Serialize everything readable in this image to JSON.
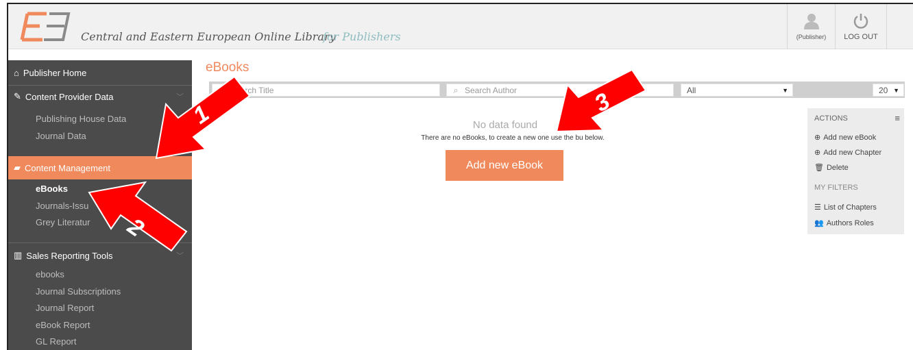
{
  "header": {
    "brand": "Central and Eastern European Online Library",
    "brand_sub": "for Publishers",
    "user_label": "(Publisher)",
    "logout_label": "LOG OUT"
  },
  "sidebar": {
    "home": "Publisher Home",
    "content_provider": {
      "label": "Content Provider Data",
      "items": [
        "Publishing House Data",
        "Journal Data"
      ]
    },
    "content_management": {
      "label": "Content Management",
      "items": [
        "eBooks",
        "Journals-Issu",
        "Grey Literatur"
      ]
    },
    "sales": {
      "label": "Sales Reporting Tools",
      "items": [
        "ebooks",
        "Journal Subscriptions",
        "Journal Report",
        "eBook Report",
        "GL Report"
      ]
    }
  },
  "main": {
    "title": "eBooks",
    "search_title_placeholder": "Search Title",
    "search_author_placeholder": "Search Author",
    "filter_select": "All",
    "page_size": "20",
    "no_data": "No data found",
    "no_data_desc": "There are no eBooks, to create a new one use the bu    below.",
    "add_button": "Add new eBook"
  },
  "actions": {
    "heading": "ACTIONS",
    "items": [
      "Add new eBook",
      "Add new Chapter",
      "Delete"
    ],
    "filters_heading": "MY FILTERS",
    "filters": [
      "List of Chapters",
      "Authors Roles"
    ]
  },
  "annotations": [
    "1",
    "2",
    "3"
  ],
  "colors": {
    "accent": "#f08a5d",
    "sidebar": "#4b4b4b",
    "arrow": "#ff0000"
  }
}
